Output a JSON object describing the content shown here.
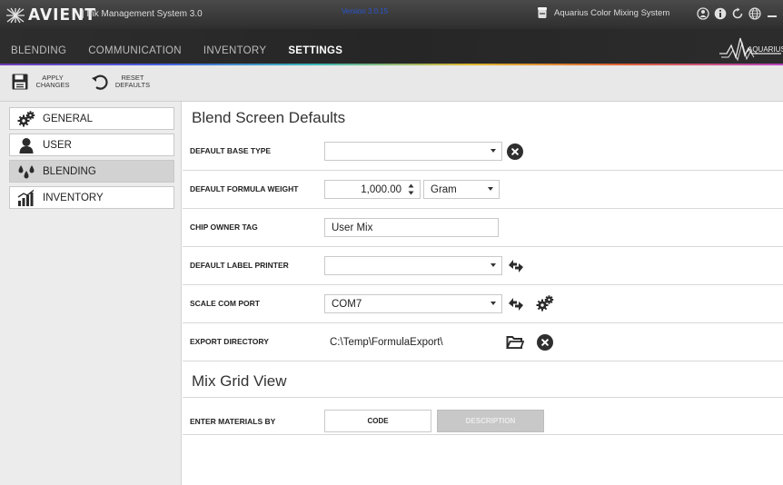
{
  "titlebar": {
    "logo_text": "AVIENT",
    "app_name": "| Ink Management System 3.0",
    "version": "Version 3.0.15",
    "system_name": "Aquarius Color Mixing System"
  },
  "nav": {
    "tabs": [
      {
        "label": "BLENDING"
      },
      {
        "label": "COMMUNICATION"
      },
      {
        "label": "INVENTORY"
      },
      {
        "label": "SETTINGS"
      }
    ],
    "active_tab": "SETTINGS",
    "brand_text": "AQUARIUS"
  },
  "toolbar": {
    "apply_label": "APPLY CHANGES",
    "reset_label": "RESET DEFAULTS"
  },
  "sidebar": {
    "items": [
      {
        "label": "GENERAL",
        "icon": "gears-icon"
      },
      {
        "label": "USER",
        "icon": "user-icon"
      },
      {
        "label": "BLENDING",
        "icon": "drops-icon"
      },
      {
        "label": "INVENTORY",
        "icon": "bar-chart-icon"
      }
    ],
    "active": "BLENDING"
  },
  "blend_defaults": {
    "title": "Blend Screen Defaults",
    "base_type_label": "DEFAULT BASE TYPE",
    "base_type_value": "",
    "formula_weight_label": "DEFAULT FORMULA WEIGHT",
    "formula_weight_value": "1,000.00",
    "formula_weight_unit": "Gram",
    "chip_owner_label": "CHIP OWNER TAG",
    "chip_owner_value": "User Mix",
    "label_printer_label": "DEFAULT LABEL PRINTER",
    "label_printer_value": "",
    "scale_port_label": "SCALE COM PORT",
    "scale_port_value": "COM7",
    "export_dir_label": "EXPORT DIRECTORY",
    "export_dir_value": "C:\\Temp\\FormulaExport\\"
  },
  "mix_grid": {
    "title": "Mix Grid View",
    "enter_by_label": "ENTER MATERIALS BY",
    "options": [
      {
        "label": "CODE",
        "selected": true
      },
      {
        "label": "DESCRIPTION",
        "selected": false
      }
    ]
  },
  "colors": {
    "titlebar": "#3a3a3a",
    "navbar": "#2b2b2b",
    "active_side": "#d2d2d2",
    "version_text": "#2a55d0"
  }
}
